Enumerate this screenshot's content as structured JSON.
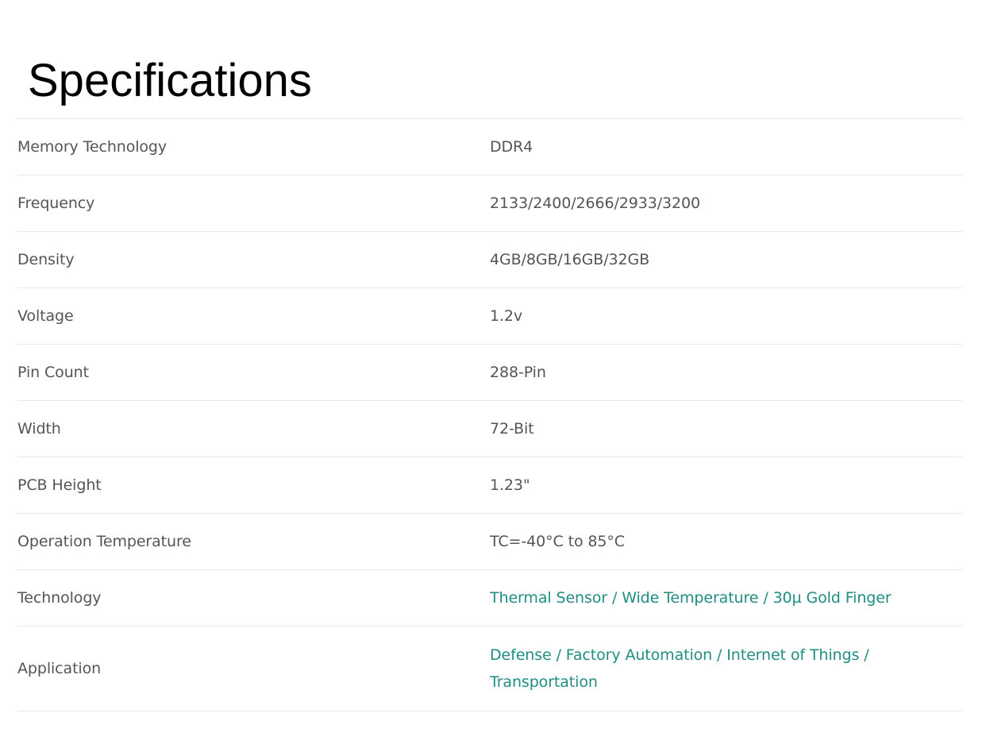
{
  "title": "Specifications",
  "rows": [
    {
      "label": "Memory Technology",
      "value": "DDR4"
    },
    {
      "label": "Frequency",
      "value": "2133/2400/2666/2933/3200"
    },
    {
      "label": "Density",
      "value": "4GB/8GB/16GB/32GB"
    },
    {
      "label": "Voltage",
      "value": "1.2v"
    },
    {
      "label": "Pin Count",
      "value": "288-Pin"
    },
    {
      "label": "Width",
      "value": "72-Bit"
    },
    {
      "label": "PCB Height",
      "value": "1.23\""
    },
    {
      "label": "Operation Temperature",
      "value": "TC=-40°C to 85°C"
    },
    {
      "label": "Technology",
      "value": "Thermal Sensor / Wide Temperature / 30µ Gold Finger"
    },
    {
      "label": "Application",
      "value": "Defense / Factory Automation / Internet of Things / Transportation"
    }
  ],
  "colors": {
    "text": "#555555",
    "link": "#1f8d80",
    "divider": "#e8e8e8"
  }
}
